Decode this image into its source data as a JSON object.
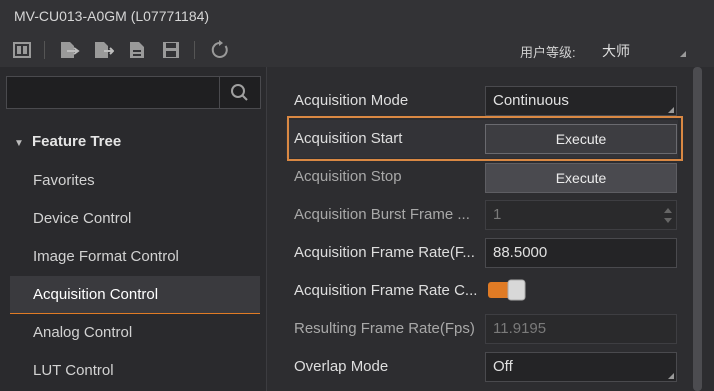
{
  "window": {
    "title": "MV-CU013-A0GM (L07771184)"
  },
  "toolbar": {
    "icons": [
      "language-icon",
      "import-icon",
      "export-icon",
      "save-file-icon",
      "save-icon",
      "refresh-icon"
    ],
    "user_level_label": "用户等级:",
    "user_level_value": "大师"
  },
  "sidebar": {
    "search_placeholder": "",
    "header": "Feature Tree",
    "items": [
      {
        "label": "Favorites"
      },
      {
        "label": "Device Control"
      },
      {
        "label": "Image Format Control"
      },
      {
        "label": "Acquisition Control",
        "selected": true
      },
      {
        "label": "Analog Control"
      },
      {
        "label": "LUT Control"
      }
    ]
  },
  "properties": [
    {
      "label": "Acquisition Mode",
      "value": "Continuous",
      "type": "dropdown"
    },
    {
      "label": "Acquisition Start",
      "value": "Execute",
      "type": "button"
    },
    {
      "label": "Acquisition Stop",
      "value": "Execute",
      "type": "button"
    },
    {
      "label": "Acquisition Burst Frame ...",
      "value": "1",
      "type": "spin-disabled"
    },
    {
      "label": "Acquisition Frame Rate(F...",
      "value": "88.5000",
      "type": "input"
    },
    {
      "label": "Acquisition Frame Rate C...",
      "value": "on",
      "type": "toggle"
    },
    {
      "label": "Resulting Frame Rate(Fps)",
      "value": "11.9195",
      "type": "readonly"
    },
    {
      "label": "Overlap Mode",
      "value": "Off",
      "type": "dropdown"
    }
  ],
  "colors": {
    "accent": "#e07b25",
    "highlight_border": "#d98843"
  }
}
